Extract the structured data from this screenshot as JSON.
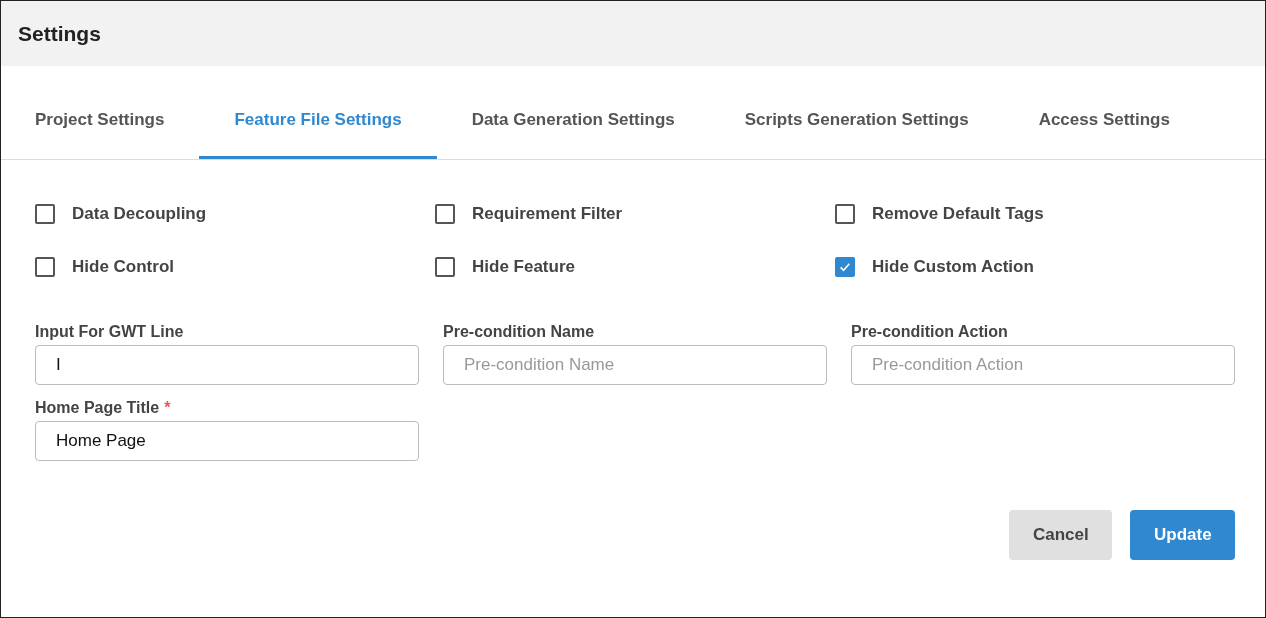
{
  "window": {
    "title": "Settings"
  },
  "tabs": [
    {
      "label": "Project Settings",
      "selected": false
    },
    {
      "label": "Feature File Settings",
      "selected": true
    },
    {
      "label": "Data Generation Settings",
      "selected": false
    },
    {
      "label": "Scripts Generation Settings",
      "selected": false
    },
    {
      "label": "Access Settings",
      "selected": false
    }
  ],
  "options": [
    {
      "label": "Data Decoupling",
      "checked": false
    },
    {
      "label": "Requirement Filter",
      "checked": false
    },
    {
      "label": "Remove Default Tags",
      "checked": false
    },
    {
      "label": "Hide Control",
      "checked": false
    },
    {
      "label": "Hide Feature",
      "checked": false
    },
    {
      "label": "Hide Custom Action",
      "checked": true
    }
  ],
  "fields": [
    {
      "label": "Input For GWT Line",
      "value": "I"
    },
    {
      "label": "Pre-condition Name",
      "placeholder": "Pre-condition Name"
    },
    {
      "label": "Pre-condition Action",
      "placeholder": "Pre-condition Action"
    },
    {
      "label": "Home Page Title",
      "value": "Home Page",
      "required_mark": "*"
    }
  ],
  "buttons": [
    {
      "label": "Cancel",
      "kind": "secondary"
    },
    {
      "label": "Update",
      "kind": "primary"
    }
  ]
}
